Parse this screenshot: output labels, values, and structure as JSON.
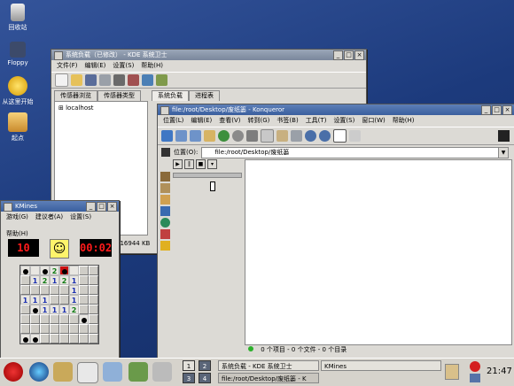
{
  "desktop": {
    "icons": [
      {
        "label": "回收站"
      },
      {
        "label": "Floppy"
      },
      {
        "label": "从这里开始"
      },
      {
        "label": "起点"
      }
    ]
  },
  "ksysguard": {
    "title": "系统负载（已修改） - KDE 系统卫士",
    "menu": [
      "文件(F)",
      "编辑(E)",
      "设置(S)",
      "帮助(H)"
    ],
    "left_tabs": [
      "传感器浏览",
      "传感器类型"
    ],
    "tree_item": "localhost",
    "right_tabs": [
      "系统负载",
      "进程表"
    ],
    "status_mem": "516944 KB"
  },
  "konqueror": {
    "title": "file:/root/Desktop/废纸篓 - Konqueror",
    "menu": [
      "位置(L)",
      "编辑(E)",
      "查看(V)",
      "转到(G)",
      "书签(B)",
      "工具(T)",
      "设置(S)",
      "窗口(W)",
      "帮助(H)"
    ],
    "location_label": "位置(O):",
    "location_value": "file:/root/Desktop/废纸篓",
    "status": "0 个项目 - 0 个文件 - 0 个目录"
  },
  "kmines": {
    "title": "KMines",
    "menu": [
      "游戏(G)",
      "建议者(A)",
      "设置(S)",
      "帮助(H)"
    ],
    "mine_counter": "10",
    "timer": "00:02",
    "grid": [
      [
        "m",
        "o",
        "m",
        "2",
        "x",
        "o",
        "",
        ""
      ],
      [
        "",
        "1",
        "2",
        "1",
        "2",
        "1",
        "",
        ""
      ],
      [
        "",
        "",
        "",
        "",
        "",
        "1",
        "",
        ""
      ],
      [
        "1",
        "1",
        "1",
        "",
        "",
        "1",
        "",
        ""
      ],
      [
        "",
        "m",
        "1",
        "1",
        "1",
        "2",
        "",
        ""
      ],
      [
        "",
        "",
        "",
        "",
        "",
        "",
        "m",
        ""
      ],
      [
        "",
        "",
        "",
        "",
        "",
        "",
        "",
        ""
      ],
      [
        "m",
        "m",
        "",
        "",
        "",
        "",
        "",
        ""
      ]
    ]
  },
  "taskbar": {
    "pager": [
      "1",
      "2",
      "3",
      "4"
    ],
    "tasks": [
      "系统负载 - KDE 系统卫士",
      "KMines",
      "file:/root/Desktop/废纸篓 - K"
    ],
    "clock": "21:47"
  }
}
